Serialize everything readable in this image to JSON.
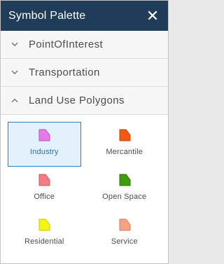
{
  "header": {
    "title": "Symbol Palette",
    "close_glyph": "✕"
  },
  "groups": [
    {
      "label": "PointOfInterest",
      "expanded": false,
      "icon": "chevron-down-icon"
    },
    {
      "label": "Transportation",
      "expanded": false,
      "icon": "chevron-down-icon"
    },
    {
      "label": "Land Use Polygons",
      "expanded": true,
      "icon": "chevron-up-icon"
    }
  ],
  "symbols": [
    {
      "label": "Industry",
      "fill": "#e57be8",
      "stroke": "#b453b8",
      "selected": true
    },
    {
      "label": "Mercantile",
      "fill": "#f25a12",
      "stroke": "#c4430a",
      "selected": false
    },
    {
      "label": "Office",
      "fill": "#f07c84",
      "stroke": "#c95b63",
      "selected": false
    },
    {
      "label": "Open Space",
      "fill": "#3f9c10",
      "stroke": "#2d730a",
      "selected": false
    },
    {
      "label": "Residential",
      "fill": "#f5f514",
      "stroke": "#c5c50a",
      "selected": false
    },
    {
      "label": "Service",
      "fill": "#f7a382",
      "stroke": "#c97e61",
      "selected": false
    }
  ],
  "colors": {
    "header_bg": "#1f3d58",
    "selection_border": "#2e7bbd",
    "selection_bg": "#e2f1fb"
  }
}
